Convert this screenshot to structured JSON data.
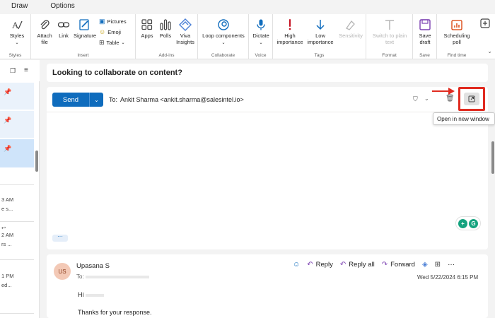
{
  "menu": {
    "tabs": [
      "Draw",
      "Options"
    ]
  },
  "ribbon": {
    "groups": {
      "styles": {
        "label": "Styles",
        "styles_btn": "Styles"
      },
      "insert": {
        "label": "Insert",
        "attach": "Attach file",
        "link": "Link",
        "signature": "Signature",
        "pictures": "Pictures",
        "emoji": "Emoji",
        "table": "Table"
      },
      "addins": {
        "label": "Add-ins",
        "apps": "Apps",
        "polls": "Polls",
        "viva": "Viva Insights"
      },
      "collaborate": {
        "label": "Collaborate",
        "loop": "Loop components"
      },
      "voice": {
        "label": "Voice",
        "dictate": "Dictate"
      },
      "tags": {
        "label": "Tags",
        "high": "High importance",
        "low": "Low importance",
        "sensitivity": "Sensitivity"
      },
      "format": {
        "label": "Format",
        "switch": "Switch to plain text"
      },
      "save": {
        "label": "Save",
        "save_draft": "Save draft"
      },
      "findtime": {
        "label": "Find time",
        "scheduling": "Scheduling poll"
      }
    },
    "accent": "#0f6cbd"
  },
  "leftlist": {
    "items": [
      {
        "time": "3 AM",
        "preview": "e s..."
      },
      {
        "time": "2 AM",
        "preview": "rs ..."
      },
      {
        "time": "1 PM",
        "preview": "ed..."
      }
    ]
  },
  "compose": {
    "subject": "Looking to collaborate on content?",
    "send_label": "Send",
    "to_label": "To:",
    "recipient": "Ankit Sharma <ankit.sharma@salesintel.io>",
    "tooltip": "Open in new window",
    "more_label": "···",
    "highlight_color": "#e02b20"
  },
  "message": {
    "avatar_initials": "US",
    "sender": "Upasana S",
    "to_prefix": "To:",
    "date": "Wed 5/22/2024 6:15 PM",
    "actions": {
      "reply": "Reply",
      "reply_all": "Reply all",
      "forward": "Forward"
    },
    "body_line1": "Hi",
    "body_line2": "Thanks for your response."
  }
}
